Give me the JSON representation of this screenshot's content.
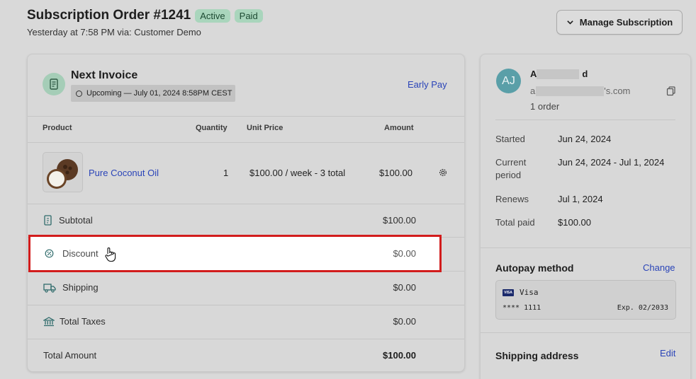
{
  "header": {
    "title": "Subscription Order #1241",
    "badge_active": "Active",
    "badge_paid": "Paid",
    "subtitle": "Yesterday at 7:58 PM via: Customer Demo",
    "manage_button": "Manage Subscription"
  },
  "invoice": {
    "title": "Next Invoice",
    "status": "Upcoming — July 01, 2024 8:58PM CEST",
    "early_pay": "Early Pay",
    "columns": {
      "product": "Product",
      "quantity": "Quantity",
      "unit_price": "Unit Price",
      "amount": "Amount"
    },
    "line_item": {
      "name": "Pure Coconut Oil",
      "quantity": "1",
      "unit_price": "$100.00 / week - 3 total",
      "amount": "$100.00"
    },
    "summary": {
      "subtotal_label": "Subtotal",
      "subtotal_value": "$100.00",
      "discount_label": "Discount",
      "discount_value": "$0.00",
      "shipping_label": "Shipping",
      "shipping_value": "$0.00",
      "taxes_label": "Total Taxes",
      "taxes_value": "$0.00",
      "total_label": "Total Amount",
      "total_value": "$100.00"
    }
  },
  "customer": {
    "initials": "AJ",
    "name_start": "A",
    "name_end": "d",
    "email_start": "a",
    "email_end": "'s.com",
    "orders": "1 order"
  },
  "details": {
    "started_label": "Started",
    "started_value": "Jun 24, 2024",
    "current_label_1": "Current",
    "current_label_2": "period",
    "current_value": "Jun 24, 2024 - Jul 1, 2024",
    "renews_label": "Renews",
    "renews_value": "Jul 1, 2024",
    "total_paid_label": "Total paid",
    "total_paid_value": "$100.00"
  },
  "autopay": {
    "heading": "Autopay method",
    "change": "Change",
    "card_brand": "Visa",
    "card_logo": "VISA",
    "card_number": "**** 1111",
    "card_expiry": "Exp. 02/2033"
  },
  "shipping": {
    "heading": "Shipping address",
    "edit": "Edit"
  },
  "colors": {
    "link": "#2a44b8",
    "badge": "#a9d5bc",
    "highlight_border": "#d21c1c"
  }
}
